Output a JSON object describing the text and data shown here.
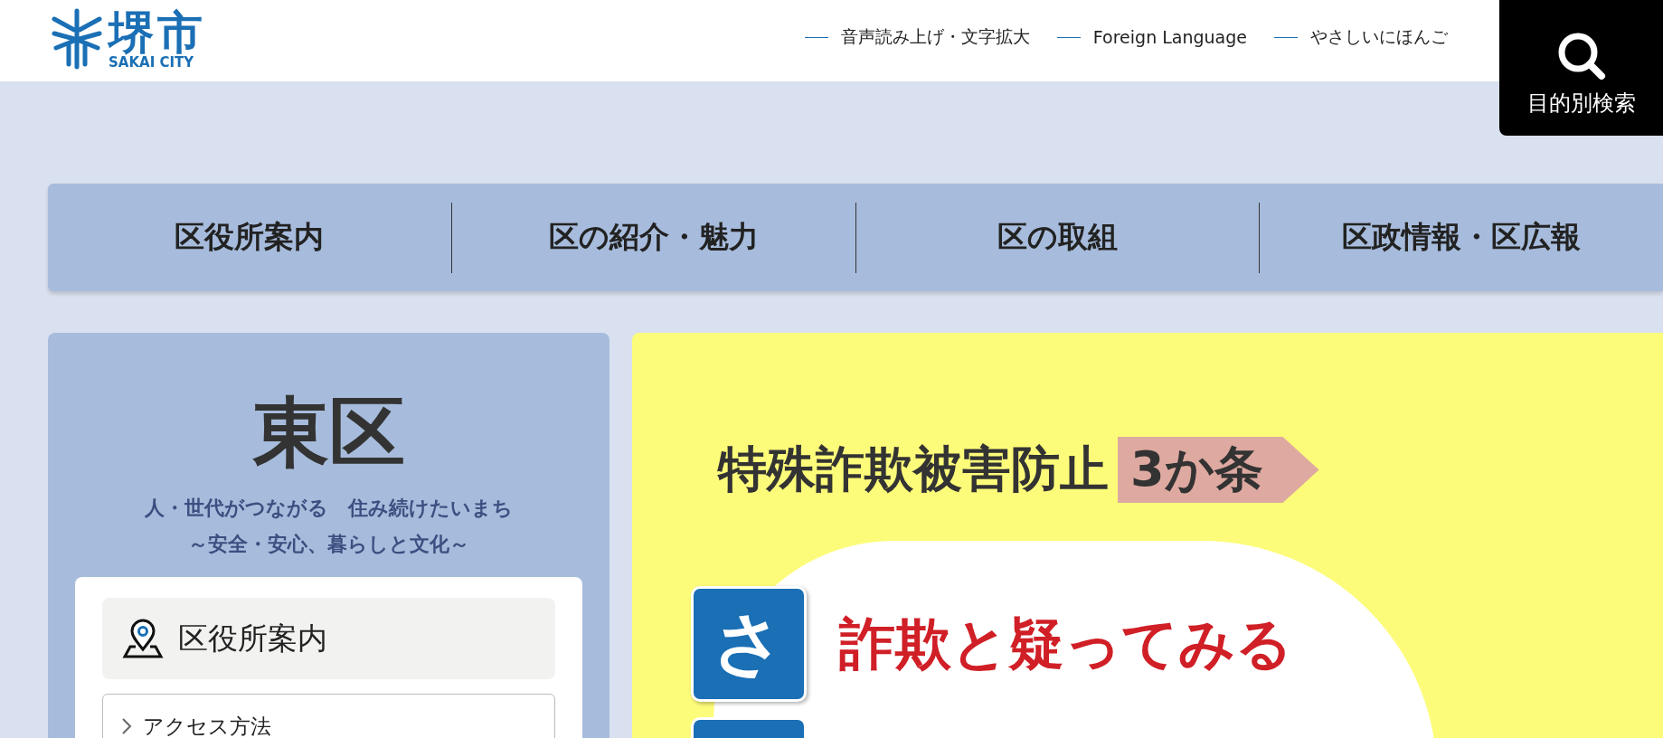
{
  "header": {
    "logo_kanji": "堺市",
    "logo_roman": "SAKAI CITY",
    "links": [
      {
        "label": "音声読み上げ・文字拡大"
      },
      {
        "label": "Foreign Language"
      },
      {
        "label": "やさしいにほんご"
      }
    ],
    "search_button": "目的別検索"
  },
  "nav": [
    {
      "label": "区役所案内"
    },
    {
      "label": "区の紹介・魅力"
    },
    {
      "label": "区の取組"
    },
    {
      "label": "区政情報・区広報"
    }
  ],
  "sidebar": {
    "title": "東区",
    "tagline": [
      "人・世代がつながる　住み続けたいまち",
      "～安全・安心、暮らしと文化～"
    ],
    "section_title": "区役所案内",
    "items": [
      {
        "label": "アクセス方法"
      }
    ]
  },
  "banner": {
    "headline": "特殊詐欺被害防止",
    "tag": "3か条",
    "rules": [
      {
        "letter": "さ",
        "text": "詐欺と疑ってみる"
      }
    ]
  }
}
